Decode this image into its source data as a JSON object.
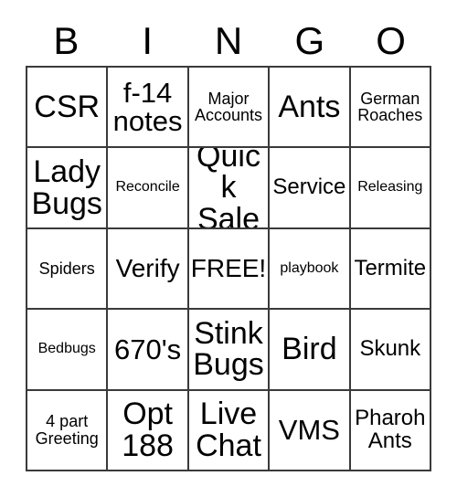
{
  "card": {
    "header_letters": [
      "B",
      "I",
      "N",
      "G",
      "O"
    ],
    "free_space_label": "FREE!",
    "rows": [
      [
        {
          "text": "CSR",
          "size": "fs-xxl"
        },
        {
          "text": "f-14 notes",
          "size": "fs-xl"
        },
        {
          "text": "Major Accounts",
          "size": "fs-sm"
        },
        {
          "text": "Ants",
          "size": "fs-xxl"
        },
        {
          "text": "German Roaches",
          "size": "fs-sm"
        }
      ],
      [
        {
          "text": "Lady Bugs",
          "size": "fs-xxl"
        },
        {
          "text": "Reconcile",
          "size": "fs-xs"
        },
        {
          "text": "Quick Sale",
          "size": "fs-xxl"
        },
        {
          "text": "Service",
          "size": "fs-md"
        },
        {
          "text": "Releasing",
          "size": "fs-xs"
        }
      ],
      [
        {
          "text": "Spiders",
          "size": "fs-sm"
        },
        {
          "text": "Verify",
          "size": "fs-lg"
        },
        {
          "text": "FREE!",
          "size": "fs-lg"
        },
        {
          "text": "playbook",
          "size": "fs-xs"
        },
        {
          "text": "Termite",
          "size": "fs-md"
        }
      ],
      [
        {
          "text": "Bedbugs",
          "size": "fs-xs"
        },
        {
          "text": "670's",
          "size": "fs-xl"
        },
        {
          "text": "Stink Bugs",
          "size": "fs-xxl"
        },
        {
          "text": "Bird",
          "size": "fs-xxl"
        },
        {
          "text": "Skunk",
          "size": "fs-md"
        }
      ],
      [
        {
          "text": "4 part Greeting",
          "size": "fs-sm"
        },
        {
          "text": "Opt 188",
          "size": "fs-xxl"
        },
        {
          "text": "Live Chat",
          "size": "fs-xxl"
        },
        {
          "text": "VMS",
          "size": "fs-xl"
        },
        {
          "text": "Pharoh Ants",
          "size": "fs-md"
        }
      ]
    ]
  },
  "colors": {
    "grid_line": "#3a3a3a",
    "text": "#000000",
    "background": "#ffffff"
  }
}
